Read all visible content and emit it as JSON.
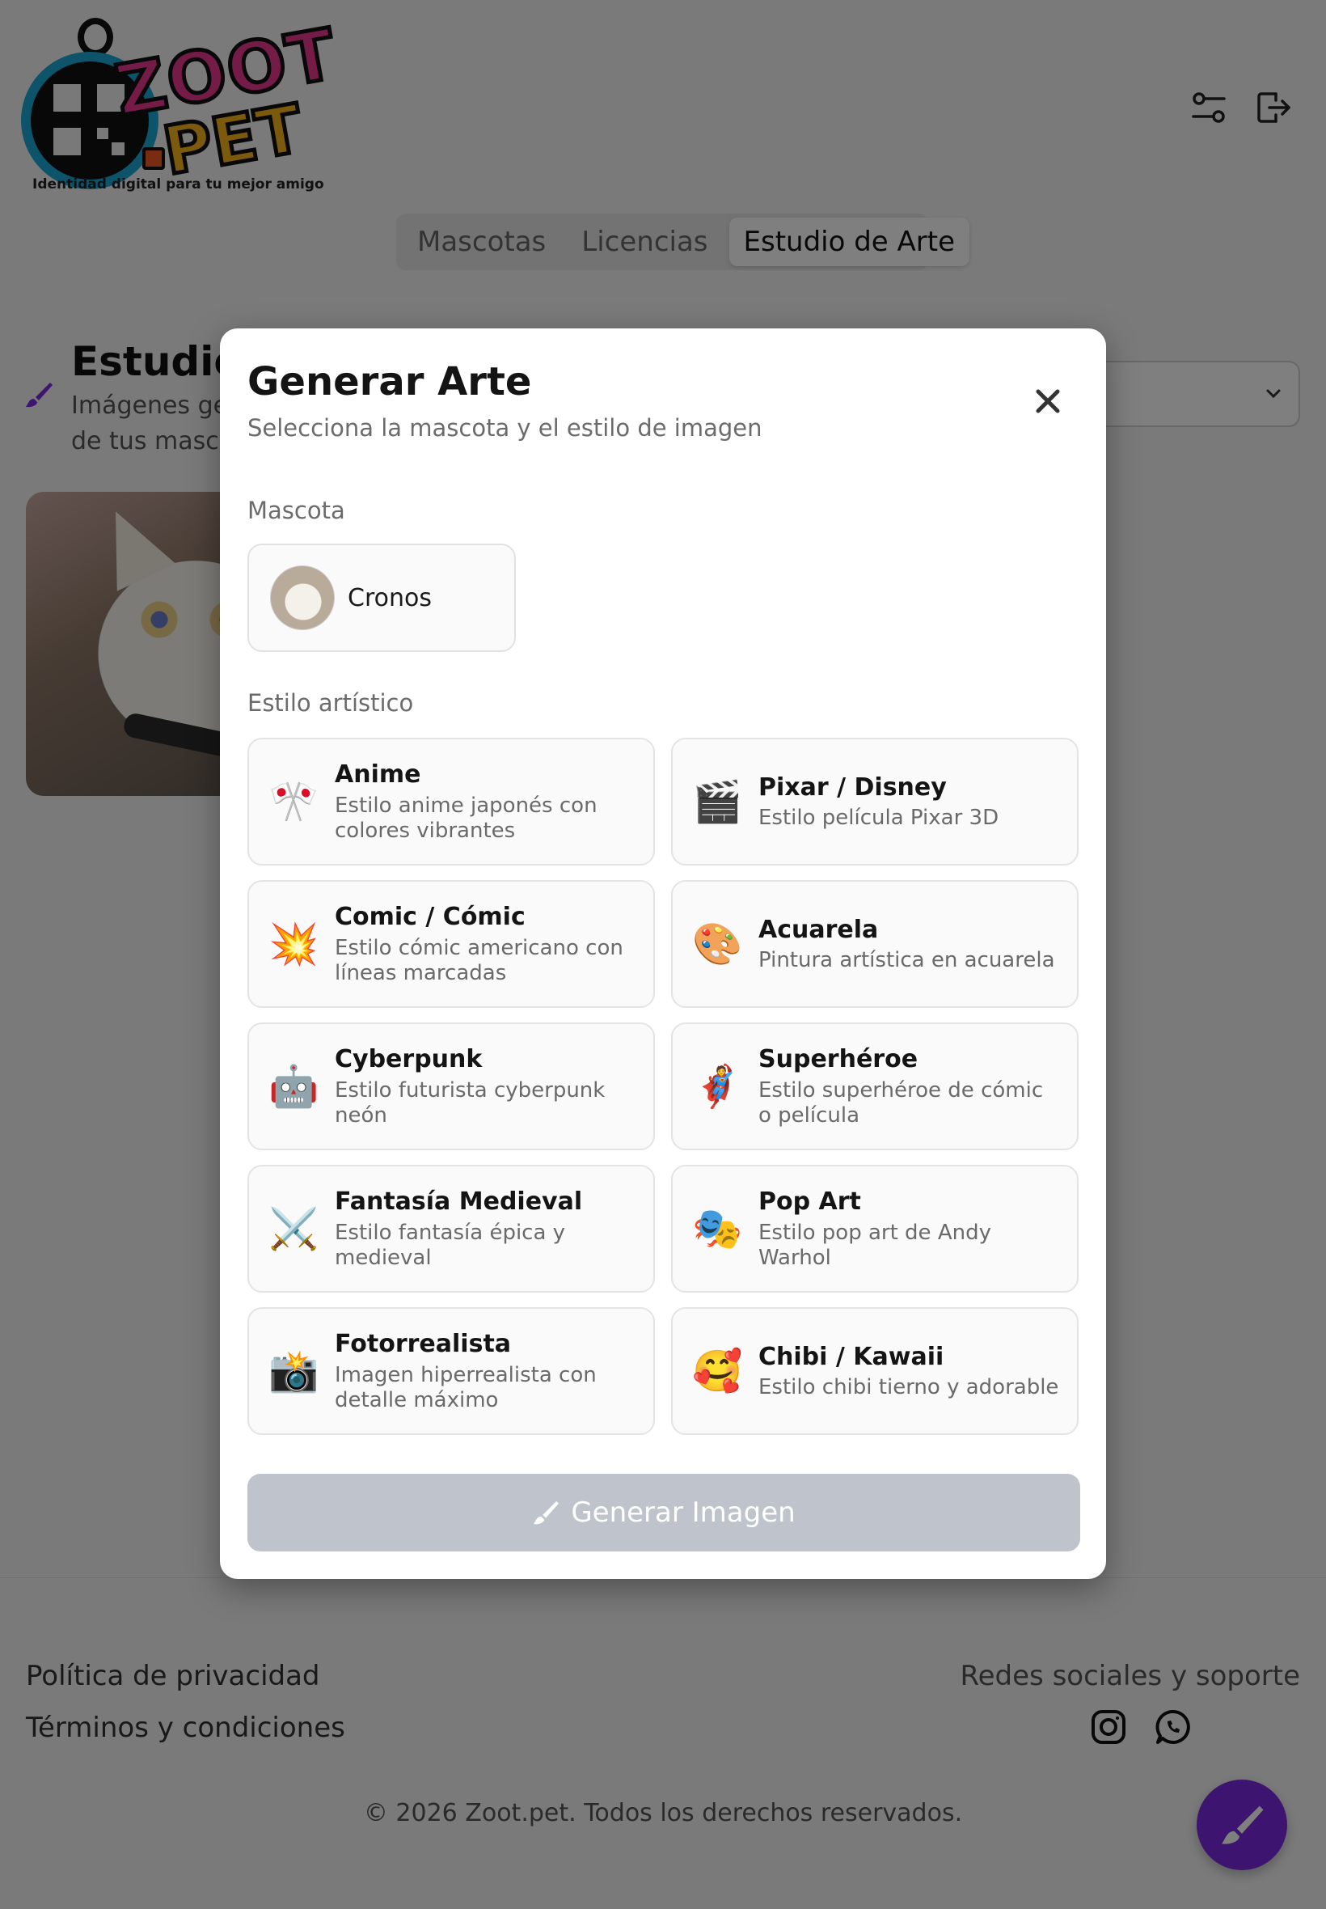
{
  "brand": {
    "name_line1": "ZOOT",
    "name_line2": "PET",
    "tagline": "Identidad digital para tu mejor amigo"
  },
  "header": {
    "icons": [
      "settings-sliders-icon",
      "logout-icon"
    ]
  },
  "nav": {
    "tabs": [
      {
        "label": "Mascotas",
        "active": false
      },
      {
        "label": "Licencias",
        "active": false
      },
      {
        "label": "Estudio de Arte",
        "active": true
      }
    ]
  },
  "studio": {
    "title": "Estudio",
    "subtitle": "Imágenes ge de tus masco"
  },
  "modal": {
    "title": "Generar Arte",
    "subtitle": "Selecciona la mascota y el estilo de imagen",
    "pet_label": "Mascota",
    "pet": {
      "name": "Cronos"
    },
    "style_label": "Estilo artístico",
    "styles": [
      {
        "emoji": "🎌",
        "name": "Anime",
        "desc": "Estilo anime japonés con colores vibrantes"
      },
      {
        "emoji": "🎬",
        "name": "Pixar / Disney",
        "desc": "Estilo película Pixar 3D"
      },
      {
        "emoji": "💥",
        "name": "Comic / Cómic",
        "desc": "Estilo cómic americano con líneas marcadas"
      },
      {
        "emoji": "🎨",
        "name": "Acuarela",
        "desc": "Pintura artística en acuarela"
      },
      {
        "emoji": "🤖",
        "name": "Cyberpunk",
        "desc": "Estilo futurista cyberpunk neón"
      },
      {
        "emoji": "🦸",
        "name": "Superhéroe",
        "desc": "Estilo superhéroe de cómic o película"
      },
      {
        "emoji": "⚔️",
        "name": "Fantasía Medieval",
        "desc": "Estilo fantasía épica y medieval"
      },
      {
        "emoji": "🎭",
        "name": "Pop Art",
        "desc": "Estilo pop art de Andy Warhol"
      },
      {
        "emoji": "📸",
        "name": "Fotorrealista",
        "desc": "Imagen hiperrealista con detalle máximo"
      },
      {
        "emoji": "🥰",
        "name": "Chibi / Kawaii",
        "desc": "Estilo chibi tierno y adorable"
      }
    ],
    "generate_label": "Generar Imagen"
  },
  "footer": {
    "privacy": "Política de privacidad",
    "terms": "Términos y condiciones",
    "social_title": "Redes sociales y soporte",
    "copyright": "© 2026 Zoot.pet. Todos los derechos reservados."
  },
  "colors": {
    "accent": "#7b2be0",
    "disabled_button": "#bfc3cb",
    "overlay": "rgba(0,0,0,0.5)"
  }
}
